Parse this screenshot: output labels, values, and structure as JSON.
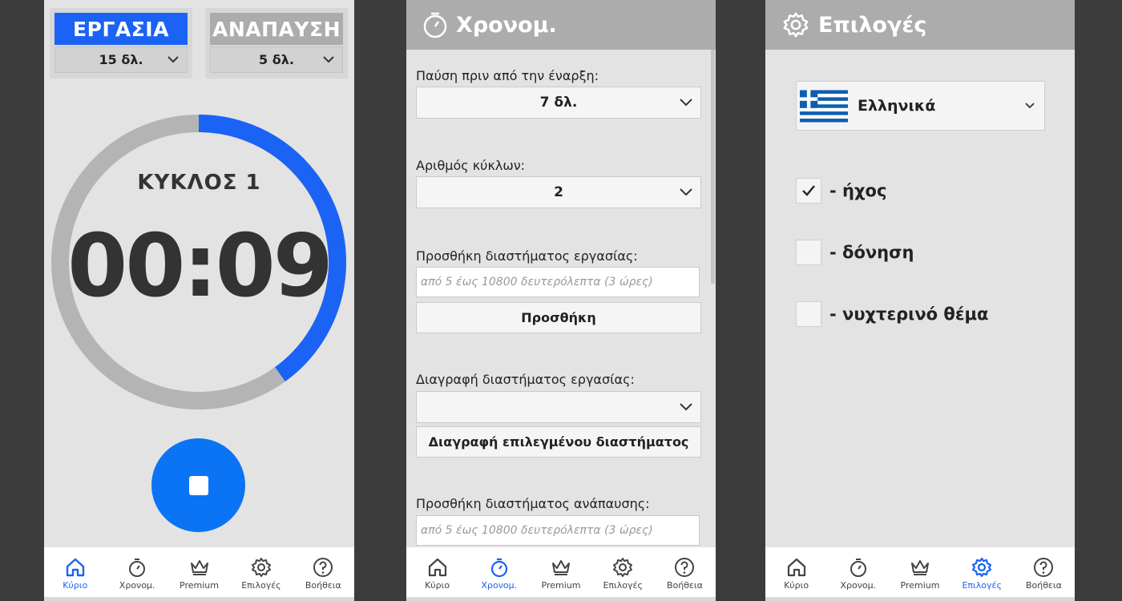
{
  "colors": {
    "accent": "#1a63f5",
    "work_button": "#1a63f5",
    "rest_button": "#acacac",
    "ring_track": "#b4b4b4",
    "ring_progress": "#1a63f5",
    "stop_button": "#0a74f5"
  },
  "nav": [
    {
      "label": "Κύριο",
      "icon": "home-icon"
    },
    {
      "label": "Χρονομ.",
      "icon": "stopwatch-icon"
    },
    {
      "label": "Premium",
      "icon": "crown-icon"
    },
    {
      "label": "Επιλογές",
      "icon": "gear-icon"
    },
    {
      "label": "Βοήθεια",
      "icon": "help-icon"
    }
  ],
  "main": {
    "work_label": "ΕΡΓΑΣΙΑ",
    "work_duration": "15 δλ.",
    "rest_label": "ΑΝΑΠΑΥΣΗ",
    "rest_duration": "5 δλ.",
    "cycle": "ΚΥΚΛΟΣ 1",
    "timer": "00:09",
    "progress_fraction": 0.4
  },
  "timer_settings": {
    "title": "Χρονομ.",
    "pause_label": "Παύση πριν από την έναρξη:",
    "pause_value": "7 δλ.",
    "cycles_label": "Αριθμός κύκλων:",
    "cycles_value": "2",
    "add_work_label": "Προσθήκη διαστήματος εργασίας:",
    "add_work_placeholder": "από 5 έως 10800 δευτερόλεπτα (3 ώρες)",
    "add_button": "Προσθήκη",
    "delete_work_label": "Διαγραφή διαστήματος εργασίας:",
    "delete_work_value": "",
    "delete_button": "Διαγραφή επιλεγμένου διαστήματος",
    "add_rest_label": "Προσθήκη διαστήματος ανάπαυσης:",
    "add_rest_placeholder": "από 5 έως 10800 δευτερόλεπτα (3 ώρες)"
  },
  "options": {
    "title": "Επιλογές",
    "language": "Ελληνικά",
    "sound_label": "- ήχος",
    "sound_checked": true,
    "vibration_label": "- δόνηση",
    "vibration_checked": false,
    "night_theme_label": "- νυχτερινό θέμα",
    "night_theme_checked": false
  }
}
